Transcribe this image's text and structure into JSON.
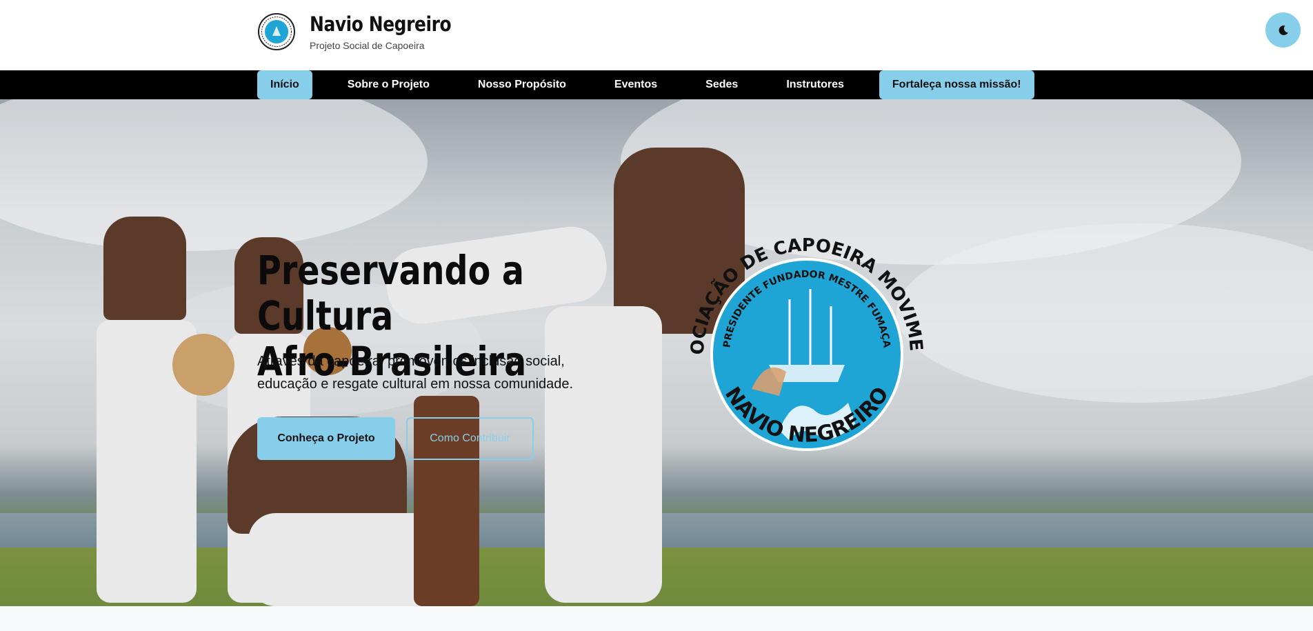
{
  "header": {
    "title": "Navio Negreiro",
    "subtitle": "Projeto Social de Capoeira",
    "logo_icon": "capoeira-association-logo",
    "theme_toggle_icon": "moon-icon"
  },
  "nav": {
    "items": [
      {
        "label": "Início",
        "active": true
      },
      {
        "label": "Sobre o Projeto"
      },
      {
        "label": "Nosso Propósito"
      },
      {
        "label": "Eventos"
      },
      {
        "label": "Sedes"
      },
      {
        "label": "Instrutores"
      }
    ],
    "cta_label": "Fortaleça nossa missão!"
  },
  "hero": {
    "title_line1": "Preservando a Cultura",
    "title_line2": "Afro-Brasileira",
    "text": "Através da capoeira, promovemos inclusão social, educação e resgate cultural em nossa comunidade.",
    "primary_button": "Conheça o Projeto",
    "secondary_button": "Como Contribuir",
    "logo": {
      "ring_text": "ASSOCIAÇÃO DE CAPOEIRA MOVIMENTO",
      "inner_text": "PRESIDENTE FUNDADOR MESTRE FUMAÇA",
      "bottom_text": "NAVIO NEGREIRO"
    }
  },
  "colors": {
    "accent": "#87ceeb",
    "nav_background": "#000000",
    "logo_blue": "#1fa4d6"
  }
}
